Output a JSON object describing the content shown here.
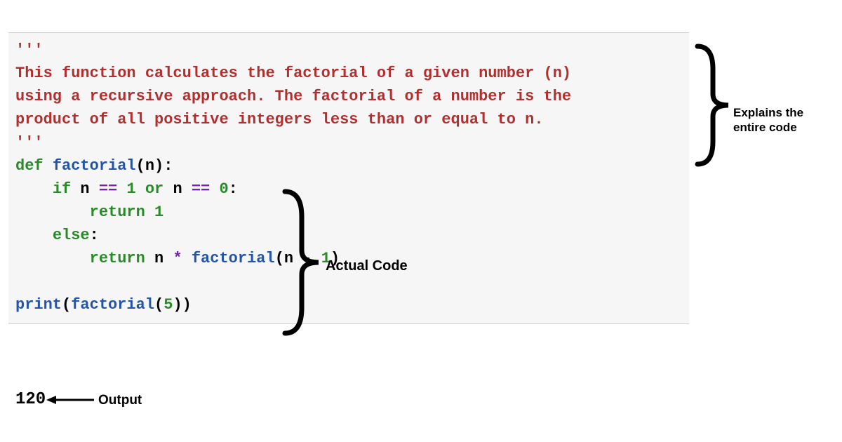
{
  "code": {
    "docstring_open": "'''",
    "doc_line1": "This function calculates the factorial of a given number (n)",
    "doc_line2": "using a recursive approach. The factorial of a number is the",
    "doc_line3": "product of all positive integers less than or equal to n.",
    "docstring_close": "'''",
    "line_def_kw": "def",
    "line_def_name": "factorial",
    "line_def_rest": "(n):",
    "line_if_pre": "    ",
    "line_if_kw1": "if",
    "line_if_mid1": " n ",
    "line_if_op1": "==",
    "line_if_sp1": " ",
    "line_if_num1": "1",
    "line_if_sp2": " ",
    "line_if_kw2": "or",
    "line_if_mid2": " n ",
    "line_if_op2": "==",
    "line_if_sp3": " ",
    "line_if_num2": "0",
    "line_if_end": ":",
    "line_ret1_pre": "        ",
    "line_ret1_kw": "return",
    "line_ret1_sp": " ",
    "line_ret1_val": "1",
    "line_else_pre": "    ",
    "line_else_kw": "else",
    "line_else_end": ":",
    "line_ret2_pre": "        ",
    "line_ret2_kw": "return",
    "line_ret2_mid": " n ",
    "line_ret2_op": "*",
    "line_ret2_sp": " ",
    "line_ret2_fn": "factorial",
    "line_ret2_open": "(n ",
    "line_ret2_minus": "-",
    "line_ret2_sp2": " ",
    "line_ret2_num": "1",
    "line_ret2_close": ")",
    "line_print_fn": "print",
    "line_print_open": "(",
    "line_print_fn2": "factorial",
    "line_print_open2": "(",
    "line_print_num": "5",
    "line_print_close": "))"
  },
  "output": "120",
  "annotations": {
    "explains_l1": "Explains the",
    "explains_l2": "entire code",
    "actual": "Actual Code",
    "output": "Output"
  },
  "colors": {
    "string": "#b03030",
    "keyword": "#2a8a2a",
    "function": "#2255aa",
    "operator": "#7722aa"
  }
}
